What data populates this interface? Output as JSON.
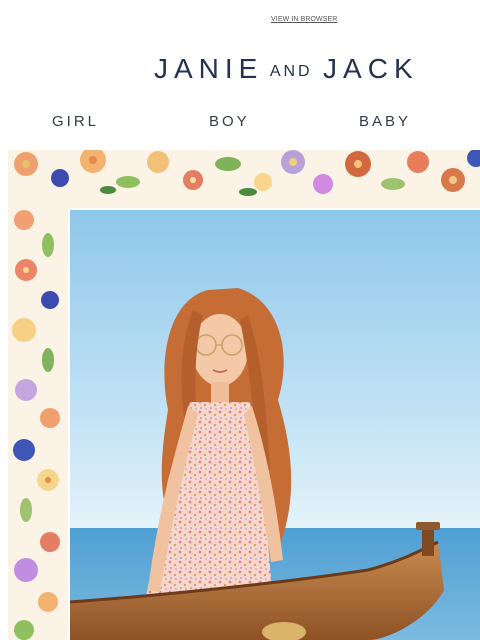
{
  "preheader": {
    "view_in_browser": "VIEW IN BROWSER"
  },
  "brand": {
    "word1": "JANIE",
    "word2": "AND",
    "word3": "JACK",
    "color": "#24324f"
  },
  "nav": {
    "items": [
      {
        "label": "GIRL"
      },
      {
        "label": "BOY"
      },
      {
        "label": "BABY"
      }
    ]
  },
  "hero": {
    "icons": [
      "floral-border",
      "girl-photo",
      "wooden-boat"
    ],
    "colors": {
      "sky": "#a9d3ef",
      "sea": "#5aa9d8",
      "boat": "#b3713e",
      "hair": "#c56d35"
    }
  }
}
